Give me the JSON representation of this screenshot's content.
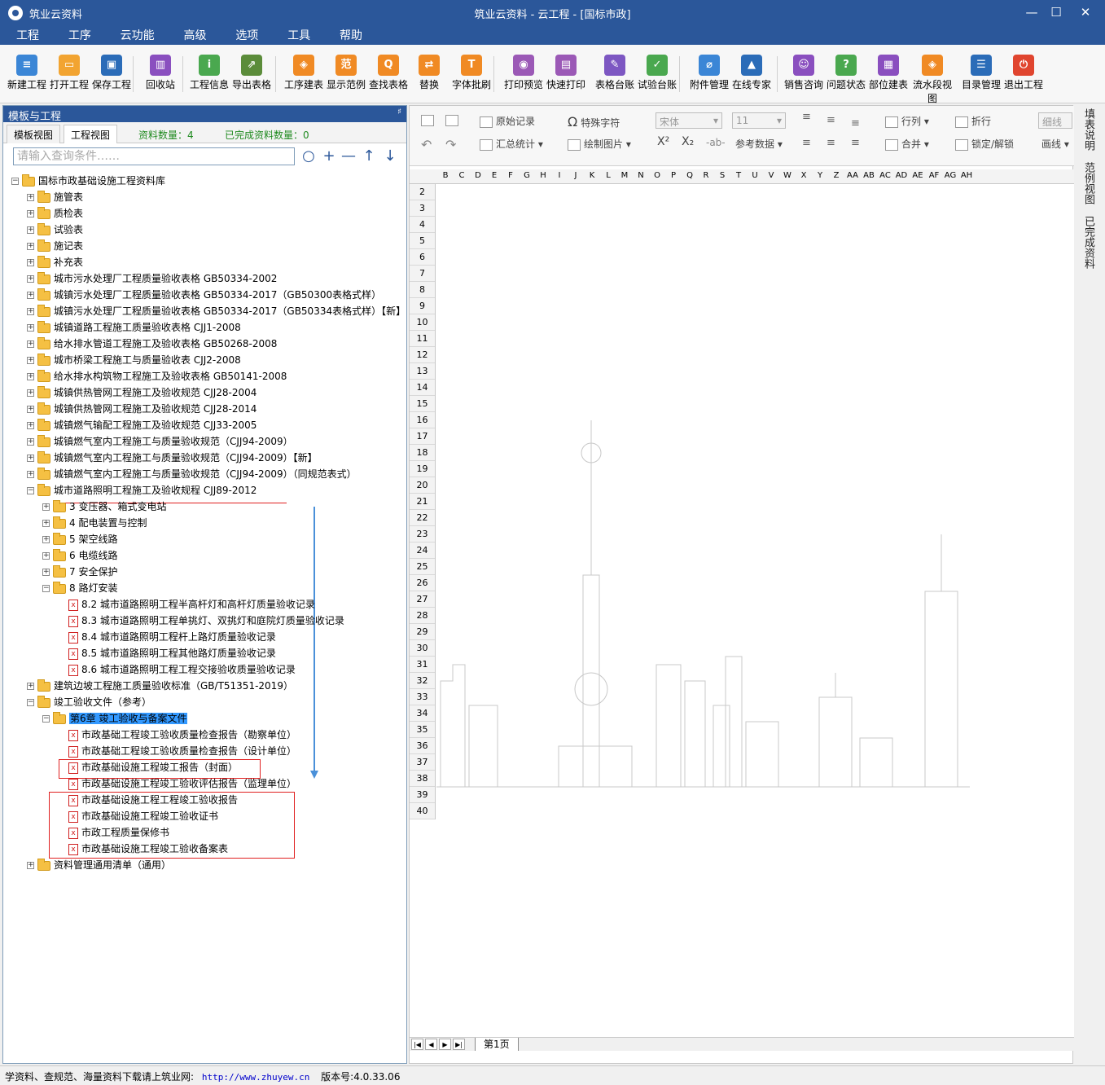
{
  "titlebar": {
    "app_name": "筑业云资料",
    "window_title": "筑业云资料 - 云工程 - [国标市政]",
    "minimize": "—",
    "maximize": "☐",
    "close": "✕"
  },
  "menu": [
    "工程",
    "工序",
    "云功能",
    "高级",
    "选项",
    "工具",
    "帮助"
  ],
  "toolbar": [
    {
      "label": "新建工程",
      "icon": "new-doc-icon",
      "color": "#3b86d6",
      "glyph": "≡"
    },
    {
      "label": "打开工程",
      "icon": "open-folder-icon",
      "color": "#f2a431",
      "glyph": "▭"
    },
    {
      "label": "保存工程",
      "icon": "save-icon",
      "color": "#2b6cb8",
      "glyph": "▣"
    },
    {
      "label": "回收站",
      "icon": "trash-icon",
      "color": "#8a4fbf",
      "glyph": "▥"
    },
    {
      "label": "工程信息",
      "icon": "info-icon",
      "color": "#4aa84f",
      "glyph": "i"
    },
    {
      "label": "导出表格",
      "icon": "export-table-icon",
      "color": "#5b8c3a",
      "glyph": "⇗"
    },
    {
      "label": "工序建表",
      "icon": "layers-icon",
      "color": "#f08a24",
      "glyph": "◈"
    },
    {
      "label": "显示范例",
      "icon": "example-icon",
      "color": "#f08a24",
      "glyph": "范"
    },
    {
      "label": "查找表格",
      "icon": "search-table-icon",
      "color": "#f08a24",
      "glyph": "Q"
    },
    {
      "label": "替换",
      "icon": "replace-icon",
      "color": "#f08a24",
      "glyph": "⇄"
    },
    {
      "label": "字体批刷",
      "icon": "font-brush-icon",
      "color": "#f08a24",
      "glyph": "T"
    },
    {
      "label": "打印预览",
      "icon": "print-preview-icon",
      "color": "#9b59b6",
      "glyph": "◉"
    },
    {
      "label": "快速打印",
      "icon": "printer-icon",
      "color": "#9b59b6",
      "glyph": "▤"
    },
    {
      "label": "表格台账",
      "icon": "ledger-icon",
      "color": "#7d57c2",
      "glyph": "✎"
    },
    {
      "label": "试验台账",
      "icon": "test-ledger-icon",
      "color": "#4aa84f",
      "glyph": "✓"
    },
    {
      "label": "附件管理",
      "icon": "attachment-icon",
      "color": "#3b86d6",
      "glyph": "⌀"
    },
    {
      "label": "在线专家",
      "icon": "expert-icon",
      "color": "#2b6cb8",
      "glyph": "▲"
    },
    {
      "label": "销售咨询",
      "icon": "consult-icon",
      "color": "#8a4fbf",
      "glyph": "☺"
    },
    {
      "label": "问题状态",
      "icon": "question-icon",
      "color": "#4aa84f",
      "glyph": "?"
    },
    {
      "label": "部位建表",
      "icon": "grid-table-icon",
      "color": "#8a4fbf",
      "glyph": "▦"
    },
    {
      "label": "流水段视图",
      "icon": "flow-view-icon",
      "color": "#f08a24",
      "glyph": "◈"
    },
    {
      "label": "目录管理",
      "icon": "catalog-icon",
      "color": "#2b6cb8",
      "glyph": "☰"
    },
    {
      "label": "退出工程",
      "icon": "power-icon",
      "color": "#e0452f",
      "glyph": "⏻"
    }
  ],
  "left_panel": {
    "title": "模板与工程",
    "pin": "♯",
    "tabs": [
      "模板视图",
      "工程视图"
    ],
    "stat_count": "资料数量：4",
    "stat_done": "已完成资料数量：0",
    "search_placeholder": "请输入查询条件……",
    "buttons": {
      "search": "○",
      "add": "+",
      "remove": "—",
      "up": "↑",
      "down": "↓"
    }
  },
  "tree": [
    {
      "level": 0,
      "type": "folder",
      "exp": "−",
      "label": "国标市政基础设施工程资料库"
    },
    {
      "level": 1,
      "type": "folder",
      "exp": "+",
      "label": "施管表"
    },
    {
      "level": 1,
      "type": "folder",
      "exp": "+",
      "label": "质检表"
    },
    {
      "level": 1,
      "type": "folder",
      "exp": "+",
      "label": "试验表"
    },
    {
      "level": 1,
      "type": "folder",
      "exp": "+",
      "label": "施记表"
    },
    {
      "level": 1,
      "type": "folder",
      "exp": "+",
      "label": "补充表"
    },
    {
      "level": 1,
      "type": "folder",
      "exp": "+",
      "label": "城市污水处理厂工程质量验收表格 GB50334-2002"
    },
    {
      "level": 1,
      "type": "folder",
      "exp": "+",
      "label": "城镇污水处理厂工程质量验收表格 GB50334-2017（GB50300表格式样）"
    },
    {
      "level": 1,
      "type": "folder",
      "exp": "+",
      "label": "城镇污水处理厂工程质量验收表格 GB50334-2017（GB50334表格式样）【新】"
    },
    {
      "level": 1,
      "type": "folder",
      "exp": "+",
      "label": "城镇道路工程施工质量验收表格 CJJ1-2008"
    },
    {
      "level": 1,
      "type": "folder",
      "exp": "+",
      "label": "给水排水管道工程施工及验收表格 GB50268-2008"
    },
    {
      "level": 1,
      "type": "folder",
      "exp": "+",
      "label": "城市桥梁工程施工与质量验收表 CJJ2-2008"
    },
    {
      "level": 1,
      "type": "folder",
      "exp": "+",
      "label": "给水排水构筑物工程施工及验收表格 GB50141-2008"
    },
    {
      "level": 1,
      "type": "folder",
      "exp": "+",
      "label": "城镇供热管网工程施工及验收规范 CJJ28-2004"
    },
    {
      "level": 1,
      "type": "folder",
      "exp": "+",
      "label": "城镇供热管网工程施工及验收规范 CJJ28-2014"
    },
    {
      "level": 1,
      "type": "folder",
      "exp": "+",
      "label": "城镇燃气输配工程施工及验收规范 CJJ33-2005"
    },
    {
      "level": 1,
      "type": "folder",
      "exp": "+",
      "label": "城镇燃气室内工程施工与质量验收规范（CJJ94-2009）"
    },
    {
      "level": 1,
      "type": "folder",
      "exp": "+",
      "label": "城镇燃气室内工程施工与质量验收规范（CJJ94-2009）【新】"
    },
    {
      "level": 1,
      "type": "folder",
      "exp": "+",
      "label": "城镇燃气室内工程施工与质量验收规范（CJJ94-2009）（同规范表式）"
    },
    {
      "level": 1,
      "type": "folder",
      "exp": "−",
      "label": "城市道路照明工程施工及验收规程 CJJ89-2012"
    },
    {
      "level": 2,
      "type": "folder",
      "exp": "+",
      "label": "3 变压器、箱式变电站"
    },
    {
      "level": 2,
      "type": "folder",
      "exp": "+",
      "label": "4 配电装置与控制"
    },
    {
      "level": 2,
      "type": "folder",
      "exp": "+",
      "label": "5 架空线路"
    },
    {
      "level": 2,
      "type": "folder",
      "exp": "+",
      "label": "6 电缆线路"
    },
    {
      "level": 2,
      "type": "folder",
      "exp": "+",
      "label": "7 安全保护"
    },
    {
      "level": 2,
      "type": "folder",
      "exp": "−",
      "label": "8 路灯安装"
    },
    {
      "level": 3,
      "type": "file",
      "exp": "",
      "label": "8.2 城市道路照明工程半高杆灯和高杆灯质量验收记录"
    },
    {
      "level": 3,
      "type": "file",
      "exp": "",
      "label": "8.3 城市道路照明工程单挑灯、双挑灯和庭院灯质量验收记录"
    },
    {
      "level": 3,
      "type": "file",
      "exp": "",
      "label": "8.4 城市道路照明工程杆上路灯质量验收记录"
    },
    {
      "level": 3,
      "type": "file",
      "exp": "",
      "label": "8.5 城市道路照明工程其他路灯质量验收记录"
    },
    {
      "level": 3,
      "type": "file",
      "exp": "",
      "label": "8.6 城市道路照明工程工程交接验收质量验收记录"
    },
    {
      "level": 1,
      "type": "folder",
      "exp": "+",
      "label": "建筑边坡工程施工质量验收标准（GB/T51351-2019）"
    },
    {
      "level": 1,
      "type": "folder",
      "exp": "−",
      "label": "竣工验收文件（参考）"
    },
    {
      "level": 2,
      "type": "folder",
      "exp": "−",
      "label": "第6章 竣工验收与备案文件",
      "selected": true
    },
    {
      "level": 3,
      "type": "file",
      "exp": "",
      "label": "市政基础工程竣工验收质量检查报告（勘察单位）"
    },
    {
      "level": 3,
      "type": "file",
      "exp": "",
      "label": "市政基础工程竣工验收质量检查报告（设计单位）"
    },
    {
      "level": 3,
      "type": "file",
      "exp": "",
      "label": "市政基础设施工程竣工报告（封面）"
    },
    {
      "level": 3,
      "type": "file",
      "exp": "",
      "label": "市政基础设施工程竣工验收评估报告（监理单位）"
    },
    {
      "level": 3,
      "type": "file",
      "exp": "",
      "label": "市政基础设施工程工程竣工验收报告"
    },
    {
      "level": 3,
      "type": "file",
      "exp": "",
      "label": "市政基础设施工程竣工验收证书"
    },
    {
      "level": 3,
      "type": "file",
      "exp": "",
      "label": "市政工程质量保修书"
    },
    {
      "level": 3,
      "type": "file",
      "exp": "",
      "label": "市政基础设施工程竣工验收备案表"
    },
    {
      "level": 1,
      "type": "folder",
      "exp": "+",
      "label": "资料管理通用清单（通用）"
    }
  ],
  "format_bar": {
    "original_record": "原始记录",
    "special_char": "特殊字符",
    "summary": "汇总统计",
    "draw_image": "绘制图片",
    "font_name": "宋体",
    "font_size": "11",
    "superscript": "X²",
    "subscript": "X₂",
    "strike": "-ab-",
    "reference_data": "参考数据",
    "row_col": "行列",
    "wrap": "折行",
    "merge": "合并",
    "lock_unlock": "锁定/解锁",
    "thin_line": "细线",
    "draw_line": "画线"
  },
  "grid": {
    "columns": [
      "B",
      "C",
      "D",
      "E",
      "F",
      "G",
      "H",
      "I",
      "J",
      "K",
      "L",
      "M",
      "N",
      "O",
      "P",
      "Q",
      "R",
      "S",
      "T",
      "U",
      "V",
      "W",
      "X",
      "Y",
      "Z",
      "AA",
      "AB",
      "AC",
      "AD",
      "AE",
      "AF",
      "AG",
      "AH"
    ],
    "rows": [
      "2",
      "3",
      "4",
      "5",
      "6",
      "7",
      "8",
      "9",
      "10",
      "11",
      "12",
      "13",
      "14",
      "15",
      "16",
      "17",
      "18",
      "19",
      "20",
      "21",
      "22",
      "23",
      "24",
      "25",
      "26",
      "27",
      "28",
      "29",
      "30",
      "31",
      "32",
      "33",
      "34",
      "35",
      "36",
      "37",
      "38",
      "39",
      "40"
    ],
    "sheet_tab": "第1页",
    "nav": [
      "|◀",
      "◀",
      "▶",
      "▶|"
    ]
  },
  "sidebar": [
    "填表说明",
    "范例视图",
    "已完成资料"
  ],
  "status": {
    "text": "学资料、查规范、海量资料下载请上筑业网:",
    "url": "http://www.zhuyew.cn",
    "version": "版本号:4.0.33.06"
  }
}
